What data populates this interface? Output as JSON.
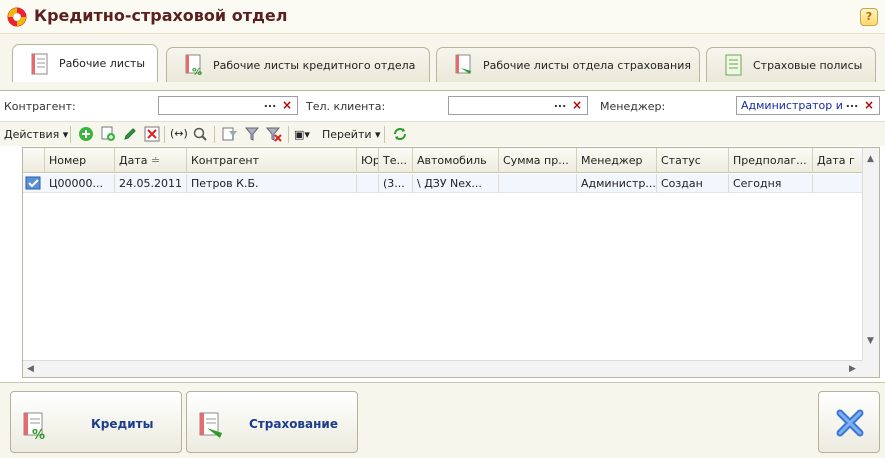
{
  "window": {
    "title": "Кредитно-страховой отдел",
    "help_label": "?"
  },
  "tabs": [
    {
      "label": "Рабочие листы",
      "icon": "worksheet-icon",
      "active": true
    },
    {
      "label": "Рабочие листы кредитного отдела",
      "icon": "credit-worksheet-icon",
      "active": false
    },
    {
      "label": "Рабочие листы отдела страхования",
      "icon": "insurance-worksheet-icon",
      "active": false
    },
    {
      "label": "Страховые полисы",
      "icon": "policy-icon",
      "active": false
    }
  ],
  "filters": {
    "counterparty_label": "Контрагент:",
    "counterparty_value": "",
    "phone_label": "Тел. клиента:",
    "phone_value": "",
    "manager_label": "Менеджер:",
    "manager_value": "Администратор и",
    "select_button": "...",
    "clear_button": "×"
  },
  "toolbar": {
    "actions_label": "Действия",
    "goto_label": "Перейти"
  },
  "table": {
    "columns": [
      "Номер",
      "Дата",
      "Контрагент",
      "Юр",
      "Те...",
      "Автомобиль",
      "Сумма пр...",
      "Менеджер",
      "Статус",
      "Предполаг...",
      "Дата г"
    ],
    "rows": [
      {
        "number": "Ц00000...",
        "date": "24.05.2011",
        "counterparty": "Петров К.Б.",
        "legal": "",
        "phone": "(3...",
        "car": "\\ ДЗУ Nex...",
        "amount": "",
        "manager": "Администр...",
        "status": "Создан",
        "expected": "Сегодня",
        "date2": ""
      }
    ]
  },
  "bottom": {
    "credits_label": "Кредиты",
    "insurance_label": "Страхование"
  },
  "colors": {
    "title": "#5a1f1f",
    "link_blue": "#1c3d8c",
    "close_x": "#3a77d6"
  }
}
